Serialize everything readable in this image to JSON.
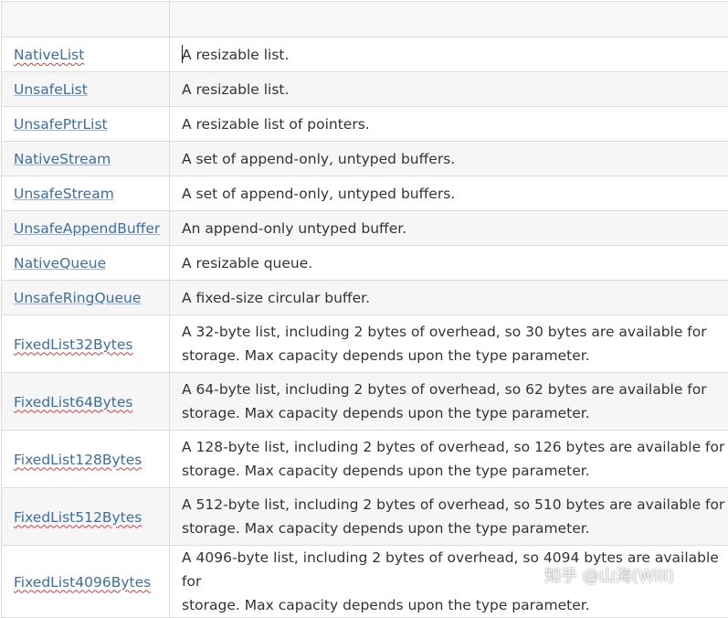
{
  "header": {
    "col1": "",
    "col2": ""
  },
  "rows": [
    {
      "name": "NativeList",
      "desc": [
        "A resizable list."
      ]
    },
    {
      "name": "UnsafeList",
      "desc": [
        "A resizable list."
      ]
    },
    {
      "name": "UnsafePtrList",
      "desc": [
        "A resizable list of pointers."
      ]
    },
    {
      "name": "NativeStream",
      "desc": [
        "A set of append-only, untyped buffers."
      ]
    },
    {
      "name": "UnsafeStream",
      "desc": [
        "A set of append-only, untyped buffers."
      ]
    },
    {
      "name": "UnsafeAppendBuffer",
      "desc": [
        "An append-only untyped buffer."
      ]
    },
    {
      "name": "NativeQueue",
      "desc": [
        "A resizable queue."
      ]
    },
    {
      "name": "UnsafeRingQueue",
      "desc": [
        "A fixed-size circular buffer."
      ]
    },
    {
      "name": "FixedList32Bytes",
      "desc": [
        "A 32-byte list, including 2 bytes of overhead, so 30 bytes are available for",
        "storage. Max capacity depends upon the type parameter."
      ]
    },
    {
      "name": "FixedList64Bytes",
      "desc": [
        "A 64-byte list, including 2 bytes of overhead, so 62 bytes are available for",
        "storage. Max capacity depends upon the type parameter."
      ]
    },
    {
      "name": "FixedList128Bytes",
      "desc": [
        "A 128-byte list, including 2 bytes of overhead, so 126 bytes are available for",
        "storage. Max capacity depends upon the type parameter."
      ]
    },
    {
      "name": "FixedList512Bytes",
      "desc": [
        "A 512-byte list, including 2 bytes of overhead, so 510 bytes are available for",
        "storage. Max capacity depends upon the type parameter."
      ]
    },
    {
      "name": "FixedList4096Bytes",
      "desc": [
        "A 4096-byte list, including 2 bytes of overhead, so 4094 bytes are available for",
        "storage. Max capacity depends upon the type parameter."
      ]
    }
  ],
  "watermark": "知乎 @山海(Will)",
  "colors": {
    "link": "#3b6ea5",
    "text": "#333333",
    "border": "#dcdcdc",
    "spellcheck": "#d23b3b"
  }
}
